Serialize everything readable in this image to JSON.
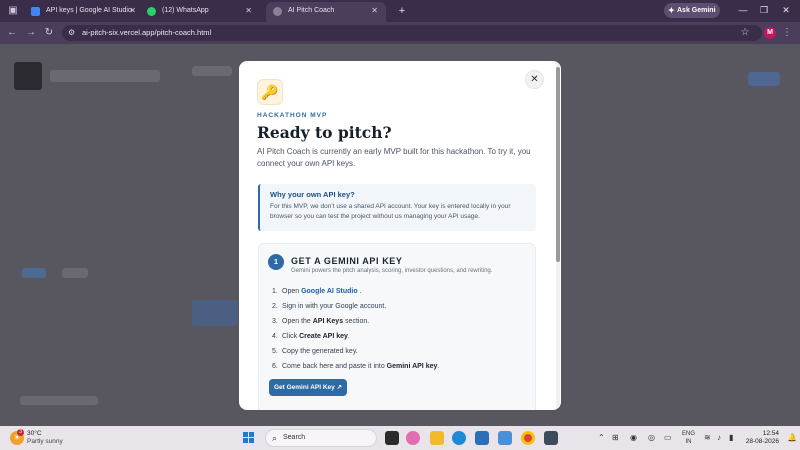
{
  "browser": {
    "tabs": [
      {
        "label": "API keys | Google AI Studio",
        "favicon_color": "#4285f4",
        "active": false
      },
      {
        "label": "(12) WhatsApp",
        "favicon_color": "#25d366",
        "active": false
      },
      {
        "label": "AI Pitch Coach",
        "favicon_color": "#8c8196",
        "active": true
      }
    ],
    "new_tab_icon": "+",
    "ask_gemini_label": "Ask Gemini",
    "url": "ai-pitch-six.vercel.app/pitch-coach.html",
    "profile_initial": "M"
  },
  "modal": {
    "icon": "key-icon",
    "eyebrow": "HACKATHON MVP",
    "title": "Ready to pitch?",
    "intro": "AI Pitch Coach is currently an early MVP built for this hackathon. To try it, you connect your own API keys.",
    "note": {
      "title": "Why your own API key?",
      "body": "For this MVP, we don’t use a shared API account. Your key is entered locally in your browser so you can test the project without us managing your API usage."
    },
    "step": {
      "number": "1",
      "title": "GET A GEMINI API KEY",
      "subtitle": "Gemini powers the pitch analysis, scoring, investor questions, and rewriting.",
      "items": [
        {
          "n": "1.",
          "pre": "Open ",
          "strong": "Google AI Studio",
          "post": " ."
        },
        {
          "n": "2.",
          "pre": "Sign in with your Google account.",
          "strong": "",
          "post": ""
        },
        {
          "n": "3.",
          "pre": "Open the ",
          "strong": "API Keys",
          "post": " section."
        },
        {
          "n": "4.",
          "pre": "Click ",
          "strong": "Create API key",
          "post": "."
        },
        {
          "n": "5.",
          "pre": "Copy the generated key.",
          "strong": "",
          "post": ""
        },
        {
          "n": "6.",
          "pre": "Come back here and paste it into ",
          "strong": "Gemini API key",
          "post": "."
        }
      ],
      "cta": "Get Gemini API Key ↗"
    }
  },
  "taskbar": {
    "weather_temp": "30°C",
    "weather_desc": "Partly sunny",
    "weather_badge": "3",
    "search_placeholder": "Search",
    "lang_line1": "ENG",
    "lang_line2": "IN",
    "time": "12:54",
    "date": "28-08-2026"
  },
  "colors": {
    "accent": "#2d6aa6",
    "browser_frame": "#3a2d4a",
    "overlay": "#58565f"
  }
}
